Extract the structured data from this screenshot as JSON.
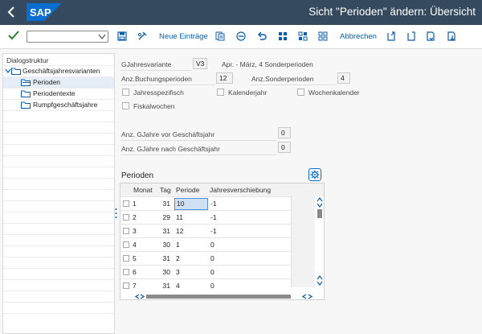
{
  "shell": {
    "logo": "SAP",
    "title": "Sicht \"Perioden\" ändern: Übersicht",
    "back_icon": "chevron-left-icon",
    "colors": {
      "shell_bg": "#354a5f",
      "logo_blue": "#0a6ed1",
      "link_blue": "#0a5ea8"
    }
  },
  "toolbar": {
    "command_field_value": "",
    "new_entries_label": "Neue Einträge",
    "cancel_label": "Abbrechen"
  },
  "sidebar": {
    "title": "Dialogstruktur",
    "items": [
      {
        "label": "Geschäftsjahresvarianten",
        "level": 0,
        "selected": false
      },
      {
        "label": "Perioden",
        "level": 1,
        "selected": true
      },
      {
        "label": "Periodentexte",
        "level": 1,
        "selected": false
      },
      {
        "label": "Rumpfgeschäftsjahre",
        "level": 1,
        "selected": false
      }
    ]
  },
  "header": {
    "variant_label": "GJahresvariante",
    "variant_value": "V3",
    "variant_desc": "Apr. - März, 4 Sonderperioden",
    "postings_label": "Anz.Buchungsperioden",
    "postings_value": "12",
    "special_label": "Anz.Sonderperioden",
    "special_value": "4",
    "checkboxes": {
      "year_dependent": "Jahresspezifisch",
      "calendar_year": "Kalenderjahr",
      "week_calendar": "Wochenkalender",
      "fiscal_weeks": "Fiskalwochen"
    },
    "years_before_label": "Anz. GJahre vor Geschäftsjahr",
    "years_before_value": "0",
    "years_after_label": "Anz. GJahre nach Geschäftsjahr",
    "years_after_value": "0"
  },
  "periods": {
    "title": "Perioden",
    "columns": [
      "Monat",
      "Tag",
      "Periode",
      "Jahresverschiebung"
    ],
    "rows": [
      {
        "month": "1",
        "day": "31",
        "period": "10",
        "shift": "-1"
      },
      {
        "month": "2",
        "day": "29",
        "period": "11",
        "shift": "-1"
      },
      {
        "month": "3",
        "day": "31",
        "period": "12",
        "shift": "-1"
      },
      {
        "month": "4",
        "day": "30",
        "period": "1",
        "shift": "0"
      },
      {
        "month": "5",
        "day": "31",
        "period": "2",
        "shift": "0"
      },
      {
        "month": "6",
        "day": "30",
        "period": "3",
        "shift": "0"
      },
      {
        "month": "7",
        "day": "31",
        "period": "4",
        "shift": "0"
      }
    ]
  }
}
